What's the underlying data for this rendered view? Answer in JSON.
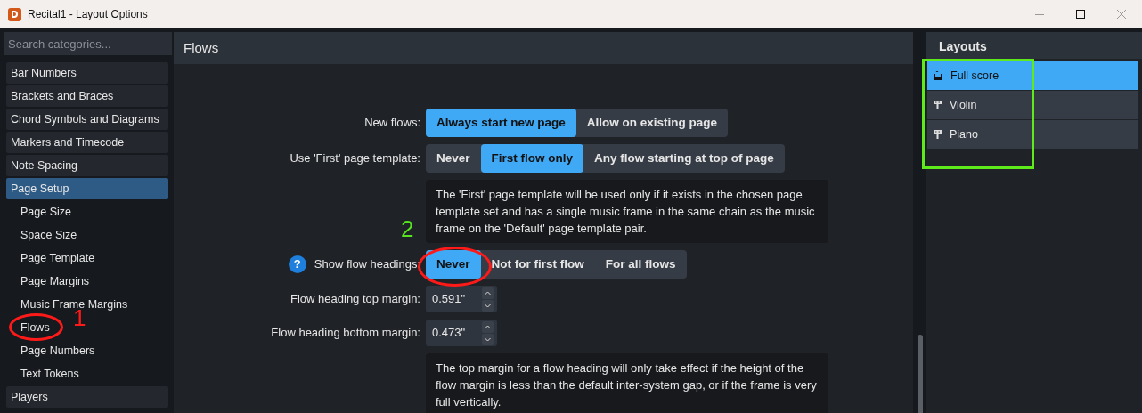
{
  "window": {
    "title": "Recital1 - Layout Options"
  },
  "sidebar": {
    "search": {
      "placeholder": "Search categories..."
    },
    "items": [
      {
        "label": "Bar Numbers",
        "kind": "category",
        "selected": false
      },
      {
        "label": "Brackets and Braces",
        "kind": "category",
        "selected": false
      },
      {
        "label": "Chord Symbols and Diagrams",
        "kind": "category",
        "selected": false
      },
      {
        "label": "Markers and Timecode",
        "kind": "category",
        "selected": false
      },
      {
        "label": "Note Spacing",
        "kind": "category",
        "selected": false
      },
      {
        "label": "Page Setup",
        "kind": "category",
        "selected": true
      },
      {
        "label": "Page Size",
        "kind": "subitem",
        "selected": false
      },
      {
        "label": "Space Size",
        "kind": "subitem",
        "selected": false
      },
      {
        "label": "Page Template",
        "kind": "subitem",
        "selected": false
      },
      {
        "label": "Page Margins",
        "kind": "subitem",
        "selected": false
      },
      {
        "label": "Music Frame Margins",
        "kind": "subitem",
        "selected": false
      },
      {
        "label": "Flows",
        "kind": "subitem",
        "selected": false
      },
      {
        "label": "Page Numbers",
        "kind": "subitem",
        "selected": false
      },
      {
        "label": "Text Tokens",
        "kind": "subitem",
        "selected": false
      },
      {
        "label": "Players",
        "kind": "category",
        "selected": false
      }
    ]
  },
  "section": {
    "title": "Flows",
    "rows": [
      {
        "kind": "choice",
        "label": "New flows:",
        "options": [
          {
            "label": "Always start new page",
            "selected": true
          },
          {
            "label": "Allow on existing page",
            "selected": false
          }
        ]
      },
      {
        "kind": "choice",
        "label": "Use 'First' page template:",
        "options": [
          {
            "label": "Never",
            "selected": false
          },
          {
            "label": "First flow only",
            "selected": true
          },
          {
            "label": "Any flow starting at top of page",
            "selected": false
          }
        ]
      },
      {
        "kind": "note",
        "text": "The 'First' page template will be used only if it exists in the chosen page template set and has a single music frame in the same chain as the music frame on the 'Default' page template pair."
      },
      {
        "kind": "choice",
        "label": "Show flow headings:",
        "help": "?",
        "options": [
          {
            "label": "Never",
            "selected": true
          },
          {
            "label": "Not for first flow",
            "selected": false
          },
          {
            "label": "For all flows",
            "selected": false
          }
        ]
      },
      {
        "kind": "number",
        "label": "Flow heading top margin:",
        "value": "0.591\""
      },
      {
        "kind": "number",
        "label": "Flow heading bottom margin:",
        "value": "0.473\""
      },
      {
        "kind": "note",
        "text": "The top margin for a flow heading will only take effect if the height of the flow margin is less than the default inter-system gap, or if the frame is very full vertically."
      }
    ]
  },
  "layouts": {
    "title": "Layouts",
    "items": [
      {
        "label": "Full score",
        "kind": "score",
        "selected": true
      },
      {
        "label": "Violin",
        "kind": "part",
        "selected": false
      },
      {
        "label": "Piano",
        "kind": "part",
        "selected": false
      }
    ]
  },
  "annotations": [
    {
      "label": "1",
      "color": "#ff1a1a"
    },
    {
      "label": "2",
      "color": "#55e61f"
    }
  ]
}
